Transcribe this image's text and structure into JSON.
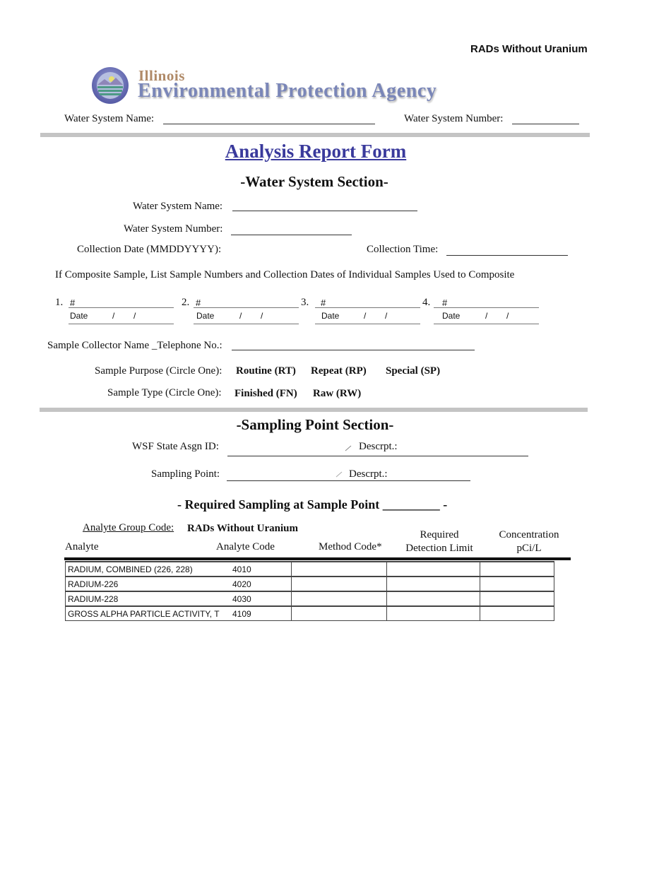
{
  "header": {
    "corner_title": "RADs Without Uranium",
    "logo_state": "Illinois",
    "logo_agency": "Environmental Protection Agency",
    "water_system_name_label": "Water System Name:",
    "water_system_number_label": "Water System Number:"
  },
  "form_title": "Analysis Report Form",
  "water_system_section": {
    "title": "-Water System Section-",
    "name_label": "Water System Name:",
    "number_label": "Water System Number:",
    "collection_date_label": "Collection Date (MMDDYYYY):",
    "collection_time_label": "Collection Time:",
    "composite_instruction": "If Composite Sample, List Sample Numbers and Collection Dates of Individual Samples Used to Composite",
    "composite_samples": [
      {
        "num": "1.",
        "hash": "#",
        "date_label": "Date",
        "sep1": "/",
        "sep2": "/"
      },
      {
        "num": "2.",
        "hash": "#",
        "date_label": "Date",
        "sep1": "/",
        "sep2": "/"
      },
      {
        "num": "3.",
        "hash": "#",
        "date_label": "Date",
        "sep1": "/",
        "sep2": "/"
      },
      {
        "num": "4.",
        "hash": "#",
        "date_label": "Date",
        "sep1": "/",
        "sep2": "/"
      }
    ],
    "collector_label": "Sample Collector Name _Telephone No.:",
    "purpose_label": "Sample Purpose (Circle One):",
    "purpose_options": [
      "Routine (RT)",
      "Repeat (RP)",
      "Special (SP)"
    ],
    "type_label": "Sample Type (Circle One):",
    "type_options": [
      "Finished (FN)",
      "Raw (RW)"
    ]
  },
  "sampling_point_section": {
    "title": "-Sampling Point Section-",
    "wsf_label": "WSF State Asgn ID:",
    "descrpt_label": "Descrpt.:",
    "sampling_point_label": "Sampling Point:",
    "descrpt_label2": "Descrpt.:"
  },
  "required_sampling": {
    "title": "- Required Sampling at Sample Point _________ -",
    "group_code_label": "Analyte Group Code:",
    "group_code_value": "RADs Without Uranium",
    "columns": [
      "Analyte",
      "Analyte Code",
      "Method Code*",
      "Required Detection Limit",
      "Concentration pCi/L"
    ],
    "col_required_l1": "Required",
    "col_required_l2": "Detection Limit",
    "col_conc_l1": "Concentration",
    "col_conc_l2": "pCi/L",
    "rows": [
      {
        "analyte": "RADIUM, COMBINED (226, 228)",
        "code": "4010",
        "method": "",
        "limit": "",
        "conc": ""
      },
      {
        "analyte": "RADIUM-226",
        "code": "4020",
        "method": "",
        "limit": "",
        "conc": ""
      },
      {
        "analyte": "RADIUM-228",
        "code": "4030",
        "method": "",
        "limit": "",
        "conc": ""
      },
      {
        "analyte": "GROSS ALPHA PARTICLE ACTIVITY, T",
        "code": "4109",
        "method": "",
        "limit": "",
        "conc": ""
      }
    ]
  },
  "colors": {
    "title_blue": "#3a3a9c",
    "divider_gray": "#c4c4c4"
  }
}
